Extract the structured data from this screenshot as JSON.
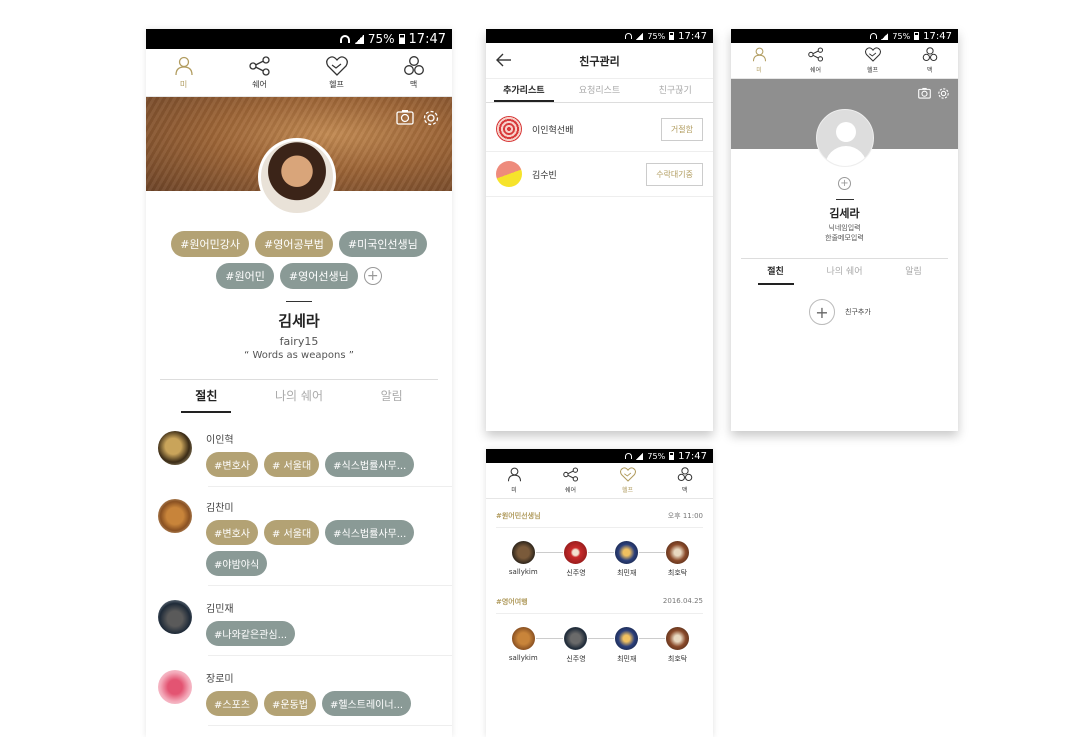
{
  "status": {
    "battery": "75%",
    "time": "17:47"
  },
  "nav": {
    "me": "미",
    "share": "쉐어",
    "help": "헬프",
    "mac": "맥"
  },
  "profile": {
    "tags": [
      "#원어민강사",
      "#영어공부법",
      "#미국인선생님",
      "#원어민",
      "#영어선생님"
    ],
    "tag_colors": [
      "gold",
      "gold",
      "gray",
      "gray",
      "gray"
    ],
    "name": "김세라",
    "id": "fairy15",
    "quote": "“ Words as weapons ”"
  },
  "profile_tabs": [
    "절친",
    "나의 쉐어",
    "알림"
  ],
  "friends": [
    {
      "name": "이인혁",
      "tags": [
        "#변호사",
        "# 서울대",
        "#식스법률사무..."
      ]
    },
    {
      "name": "김찬미",
      "tags": [
        "#변호사",
        "# 서울대",
        "#식스법률사무...",
        "#야밤야식"
      ]
    },
    {
      "name": "김민재",
      "tags": [
        "#나와같은관심..."
      ]
    },
    {
      "name": "장로미",
      "tags": [
        "#스포츠",
        "#운동법",
        "#헬스트레이너..."
      ]
    }
  ],
  "friend_mgmt": {
    "title": "친구관리",
    "tabs": [
      "추가리스트",
      "요청리스트",
      "친구끊기"
    ],
    "rows": [
      {
        "name": "이인혁선배",
        "button": "거절함"
      },
      {
        "name": "김수빈",
        "button": "수락대기중"
      }
    ]
  },
  "empty_profile": {
    "name": "김세라",
    "nickname_placeholder": "닉네임입력",
    "memo_placeholder": "한줄메모입력",
    "tabs": [
      "절친",
      "나의 쉐어",
      "알림"
    ],
    "add_friend": "친구추가"
  },
  "help_feed": {
    "groups": [
      {
        "tag": "#원어민선생님",
        "time": "오후 11:00",
        "members": [
          "sallykim",
          "신주영",
          "최민재",
          "최호탁"
        ]
      },
      {
        "tag": "#영어여행",
        "time": "2016.04.25",
        "members": [
          "sallykim",
          "신주영",
          "최민재",
          "최호탁"
        ]
      }
    ]
  },
  "colors": {
    "accent_gold": "#b3a274",
    "tag_gray": "#8a9a96"
  }
}
